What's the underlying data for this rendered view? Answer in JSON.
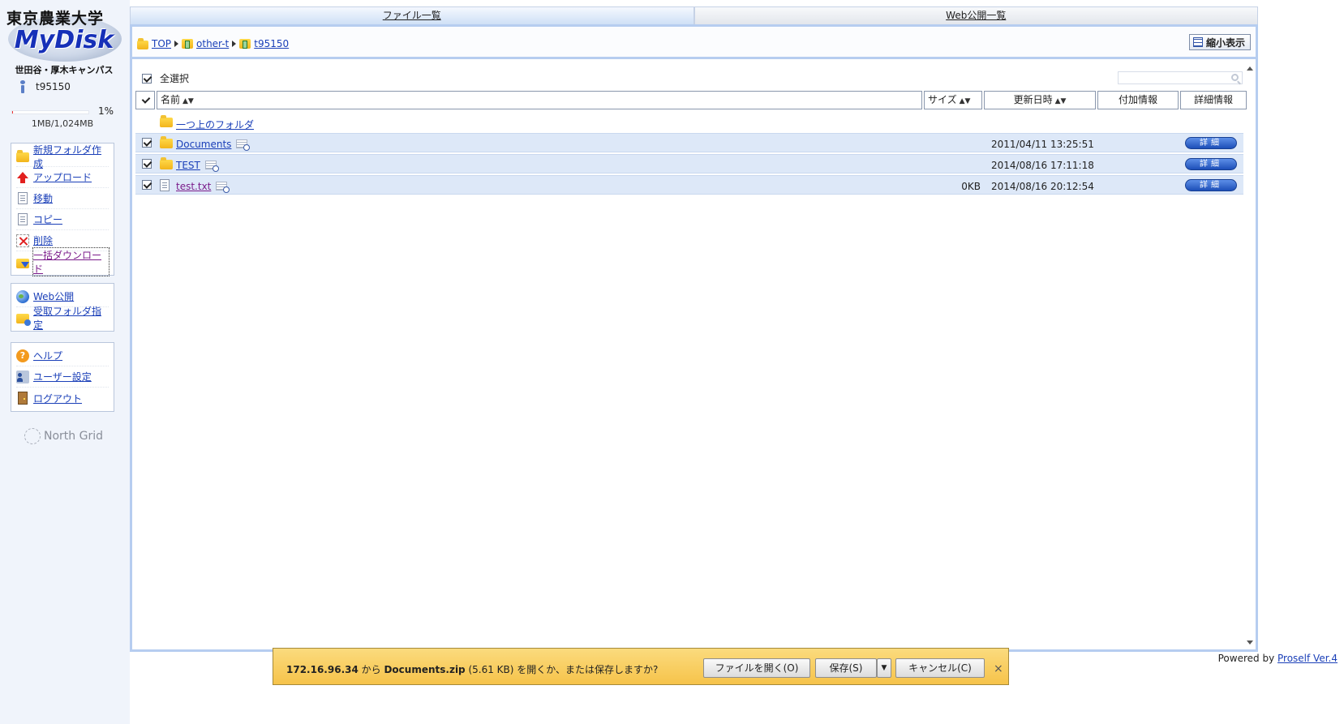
{
  "brand": {
    "university": "東京農業大学",
    "product": "MyDisk",
    "campus": "世田谷・厚木キャンパス",
    "footer_logo": "North Grid"
  },
  "user": {
    "name": "t95150"
  },
  "quota": {
    "percent_text": "1%",
    "percent": 1,
    "usage": "1MB/1,024MB"
  },
  "menu": {
    "group1": [
      {
        "label": "新規フォルダ作成",
        "icon": "new-folder-icon"
      },
      {
        "label": "アップロード",
        "icon": "upload-icon"
      },
      {
        "label": "移動",
        "icon": "move-icon"
      },
      {
        "label": "コピー",
        "icon": "copy-icon"
      },
      {
        "label": "削除",
        "icon": "delete-icon"
      },
      {
        "label": "一括ダウンロード",
        "icon": "bulk-download-icon"
      }
    ],
    "group2": [
      {
        "label": "Web公開",
        "icon": "globe-icon"
      },
      {
        "label": "受取フォルダ指定",
        "icon": "receive-folder-icon"
      }
    ],
    "group3": [
      {
        "label": "ヘルプ",
        "icon": "help-icon"
      },
      {
        "label": "ユーザー設定",
        "icon": "user-settings-icon"
      },
      {
        "label": "ログアウト",
        "icon": "logout-icon"
      }
    ]
  },
  "tabs": [
    {
      "label": "ファイル一覧",
      "active": true
    },
    {
      "label": "Web公開一覧",
      "active": false
    }
  ],
  "breadcrumb": [
    "TOP",
    "other-t",
    "t95150"
  ],
  "view_button": "縮小表示",
  "select_all": "全選択",
  "search": {
    "placeholder": ""
  },
  "columns": {
    "name": "名前",
    "size": "サイズ",
    "modified": "更新日時",
    "extra": "付加情報",
    "details": "詳細情報"
  },
  "up_folder": "一つ上のフォルダ",
  "files": [
    {
      "name": "Documents",
      "type": "folder",
      "size": "",
      "modified": "2011/04/11 13:25:51",
      "checked": true
    },
    {
      "name": "TEST",
      "type": "folder",
      "size": "",
      "modified": "2014/08/16 17:11:18",
      "checked": true
    },
    {
      "name": "test.txt",
      "type": "file",
      "size": "0KB",
      "modified": "2014/08/16 20:12:54",
      "checked": true
    }
  ],
  "detail_button": "詳細",
  "powered": {
    "prefix": "Powered by ",
    "link": "Proself Ver.4"
  },
  "download_bar": {
    "host": "172.16.96.34",
    "from": " から ",
    "filename": "Documents.zip",
    "size": " (5.61 KB) ",
    "question": "を開くか、または保存しますか?",
    "open": "ファイルを開く(O)",
    "save": "保存(S)",
    "cancel": "キャンセル(C)",
    "close": "×"
  }
}
